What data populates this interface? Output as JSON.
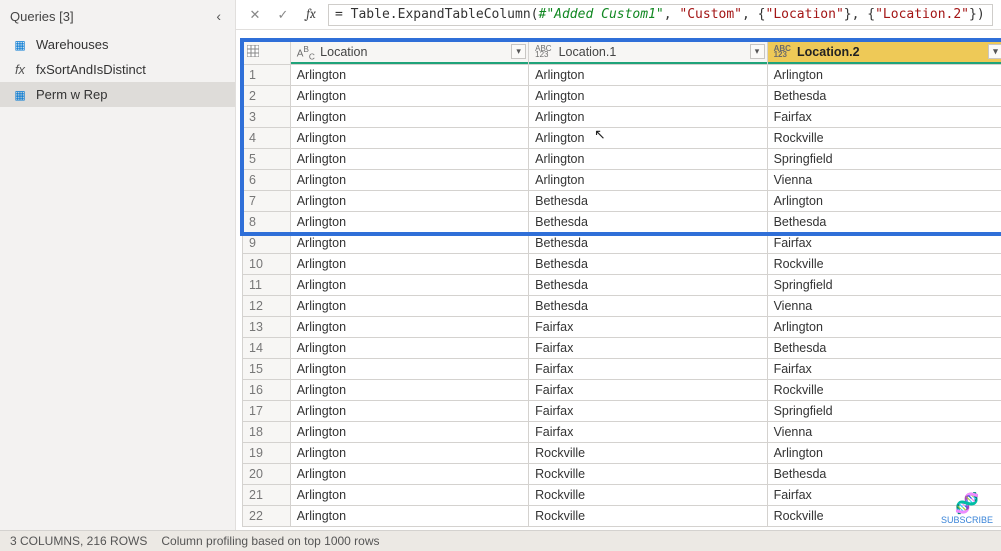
{
  "sidebar": {
    "title": "Queries [3]",
    "items": [
      {
        "label": "Warehouses",
        "icon": "table",
        "selected": false
      },
      {
        "label": "fxSortAndIsDistinct",
        "icon": "fx",
        "selected": false
      },
      {
        "label": "Perm w Rep",
        "icon": "table",
        "selected": true
      }
    ]
  },
  "formula_bar": {
    "cancel_glyph": "✕",
    "commit_glyph": "✓",
    "fx_glyph": "fx",
    "prefix": "= Table.ExpandTableColumn(",
    "step_ref": "#\"Added Custom1\"",
    "sep1": ", ",
    "arg1": "\"Custom\"",
    "sep2": ", {",
    "arg2": "\"Location\"",
    "sep3": "}, {",
    "arg3": "\"Location.2\"",
    "suffix": "})"
  },
  "grid": {
    "columns": [
      {
        "name": "Location",
        "type_icon": "ABC",
        "selected": false
      },
      {
        "name": "Location.1",
        "type_icon": "ABC123",
        "selected": false
      },
      {
        "name": "Location.2",
        "type_icon": "ABC123",
        "selected": true
      }
    ],
    "rows": [
      [
        "Arlington",
        "Arlington",
        "Arlington"
      ],
      [
        "Arlington",
        "Arlington",
        "Bethesda"
      ],
      [
        "Arlington",
        "Arlington",
        "Fairfax"
      ],
      [
        "Arlington",
        "Arlington",
        "Rockville"
      ],
      [
        "Arlington",
        "Arlington",
        "Springfield"
      ],
      [
        "Arlington",
        "Arlington",
        "Vienna"
      ],
      [
        "Arlington",
        "Bethesda",
        "Arlington"
      ],
      [
        "Arlington",
        "Bethesda",
        "Bethesda"
      ],
      [
        "Arlington",
        "Bethesda",
        "Fairfax"
      ],
      [
        "Arlington",
        "Bethesda",
        "Rockville"
      ],
      [
        "Arlington",
        "Bethesda",
        "Springfield"
      ],
      [
        "Arlington",
        "Bethesda",
        "Vienna"
      ],
      [
        "Arlington",
        "Fairfax",
        "Arlington"
      ],
      [
        "Arlington",
        "Fairfax",
        "Bethesda"
      ],
      [
        "Arlington",
        "Fairfax",
        "Fairfax"
      ],
      [
        "Arlington",
        "Fairfax",
        "Rockville"
      ],
      [
        "Arlington",
        "Fairfax",
        "Springfield"
      ],
      [
        "Arlington",
        "Fairfax",
        "Vienna"
      ],
      [
        "Arlington",
        "Rockville",
        "Arlington"
      ],
      [
        "Arlington",
        "Rockville",
        "Bethesda"
      ],
      [
        "Arlington",
        "Rockville",
        "Fairfax"
      ],
      [
        "Arlington",
        "Rockville",
        "Rockville"
      ]
    ]
  },
  "status_bar": {
    "columns_info": "3 COLUMNS, 216 ROWS",
    "profiling_info": "Column profiling based on top 1000 rows"
  },
  "subscribe": {
    "label": "SUBSCRIBE",
    "glyph": "🧬"
  },
  "icons": {
    "dropdown_glyph": "▾",
    "collapse_glyph": "‹",
    "cursor_glyph": "↖"
  }
}
